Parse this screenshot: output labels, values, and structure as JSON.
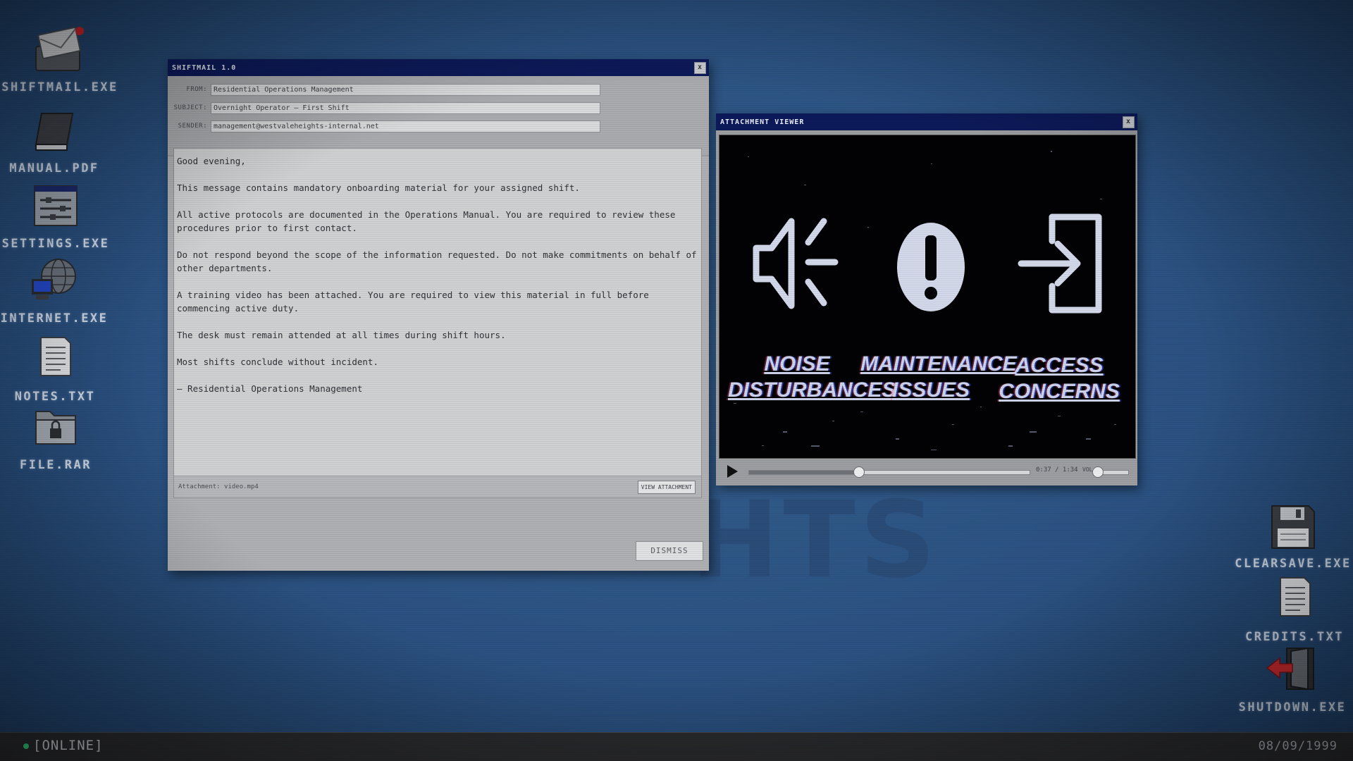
{
  "desktop": {
    "left_icons": [
      {
        "label": "SHIFTMAIL.EXE",
        "icon": "mail-icon"
      },
      {
        "label": "MANUAL.PDF",
        "icon": "book-icon"
      },
      {
        "label": "SETTINGS.EXE",
        "icon": "settings-icon"
      },
      {
        "label": "INTERNET.EXE",
        "icon": "globe-computer-icon"
      },
      {
        "label": "NOTES.TXT",
        "icon": "document-icon"
      },
      {
        "label": "FILE.RAR",
        "icon": "locked-folder-icon"
      }
    ],
    "right_icons": [
      {
        "label": "CLEARSAVE.EXE",
        "icon": "floppy-icon"
      },
      {
        "label": "CREDITS.TXT",
        "icon": "document-icon"
      },
      {
        "label": "SHUTDOWN.EXE",
        "icon": "exit-door-icon"
      }
    ],
    "background_text": "HTS"
  },
  "mail": {
    "title": "SHIFTMAIL 1.0",
    "close": "x",
    "fields": [
      {
        "label": "FROM:",
        "value": "Residential Operations Management"
      },
      {
        "label": "SUBJECT:",
        "value": "Overnight Operator — First Shift"
      },
      {
        "label": "SENDER:",
        "value": "management@westvaleheights-internal.net"
      }
    ],
    "paragraphs": [
      "Good evening,",
      "This message contains mandatory onboarding material for your assigned shift.",
      "All active protocols are documented in the Operations Manual. You are required to review these procedures prior to first contact.",
      "Do not respond beyond the scope of the information requested. Do not make commitments on behalf of other departments.",
      "A training video has been attached. You are required to view this material in full before commencing active duty.",
      "The desk must remain attended at all times during shift hours.",
      "Most shifts conclude without incident.",
      "— Residential Operations Management"
    ],
    "attachment": "Attachment: video.mp4",
    "view_attachment": "VIEW ATTACHMENT",
    "dismiss": "DISMISS"
  },
  "viewer": {
    "title": "ATTACHMENT VIEWER",
    "close": "x",
    "frame": {
      "items": [
        {
          "icon": "speaker-icon",
          "line1": "NOISE",
          "line2": "DISTURBANCES"
        },
        {
          "icon": "alert-icon",
          "line1": "MAINTENANCE",
          "line2": "ISSUES"
        },
        {
          "icon": "enter-icon",
          "line1": "ACCESS",
          "line2": "CONCERNS"
        }
      ]
    },
    "time": "0:37 / 1:34",
    "progress": 0.39,
    "volume_label": "VOL",
    "volume": 0.0
  },
  "taskbar": {
    "status": "[ONLINE]",
    "status_color": "#34d17a",
    "date": "08/09/1999"
  }
}
